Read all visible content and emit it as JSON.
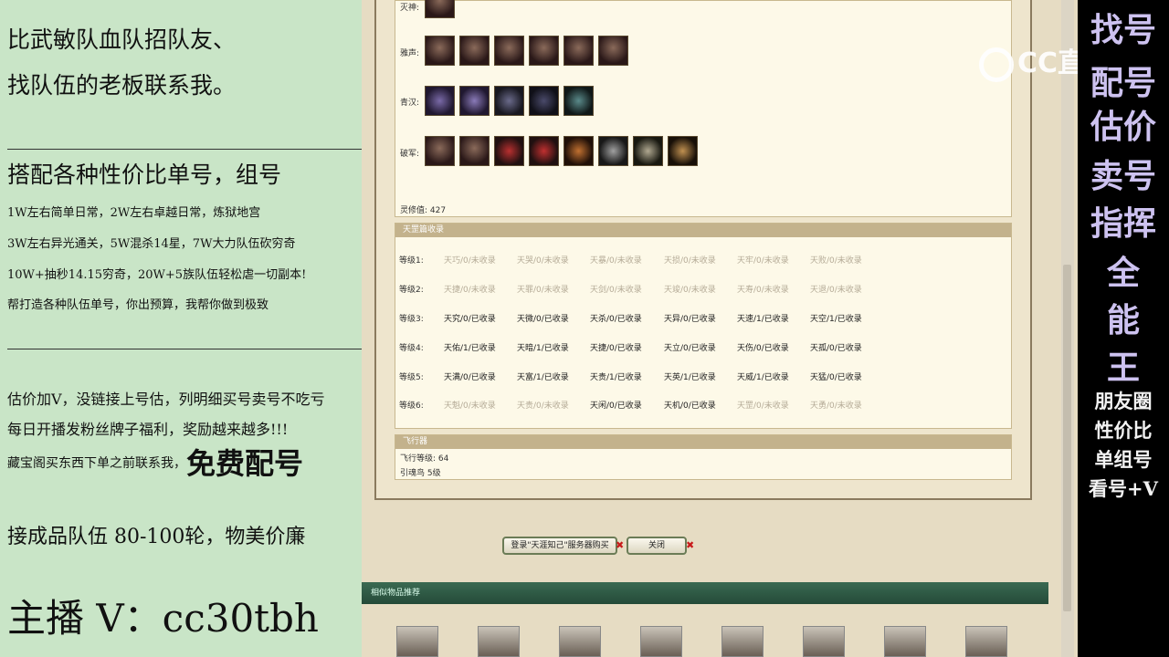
{
  "left_panel": {
    "line1": "比武敏队血队招队友、",
    "line2": "找队伍的老板联系我。",
    "line3": "搭配各种性价比单号，组号",
    "line4": "1W左右简单日常，2W左右卓越日常，炼狱地宫",
    "line5": "3W左右异光通关，5W混杀14星，7W大力队伍砍穷奇",
    "line6": "10W+抽秒14.15穷奇，20W+5族队伍轻松虐一切副本!",
    "line7": "帮打造各种队伍单号，你出预算，我帮你做到极致",
    "line8": "估价加V，没链接上号估，列明细买号卖号不吃亏",
    "line9": "每日开播发粉丝牌子福利，奖励越来越多!!!",
    "line10a": "藏宝阁买东西下单之前联系我，",
    "line10b": "免费配号",
    "line11": "接成品队伍 80-100轮，物美价廉",
    "line12": "主播 V：cc30tbh"
  },
  "equipment": {
    "row1_label": "灭神:",
    "row2_label": "雅声:",
    "row3_label": "青汉:",
    "row4_label": "破军:",
    "lingxiu_label": "灵修值: 427"
  },
  "tiangang": {
    "header": "天罡篇收录",
    "rows": [
      {
        "level": "等级1:",
        "cells": [
          "天巧/0/未收录",
          "天哭/0/未收录",
          "天暴/0/未收录",
          "天损/0/未收录",
          "天牢/0/未收录",
          "天败/0/未收录"
        ],
        "on": [
          false,
          false,
          false,
          false,
          false,
          false
        ]
      },
      {
        "level": "等级2:",
        "cells": [
          "天捷/0/未收录",
          "天罪/0/未收录",
          "天剑/0/未收录",
          "天竣/0/未收录",
          "天寿/0/未收录",
          "天退/0/未收录"
        ],
        "on": [
          false,
          false,
          false,
          false,
          false,
          false
        ]
      },
      {
        "level": "等级3:",
        "cells": [
          "天究/0/已收录",
          "天微/0/已收录",
          "天杀/0/已收录",
          "天异/0/已收录",
          "天速/1/已收录",
          "天空/1/已收录"
        ],
        "on": [
          true,
          true,
          true,
          true,
          true,
          true
        ]
      },
      {
        "level": "等级4:",
        "cells": [
          "天佑/1/已收录",
          "天暗/1/已收录",
          "天捷/0/已收录",
          "天立/0/已收录",
          "天伤/0/已收录",
          "天孤/0/已收录"
        ],
        "on": [
          true,
          true,
          true,
          true,
          true,
          true
        ]
      },
      {
        "level": "等级5:",
        "cells": [
          "天满/0/已收录",
          "天富/1/已收录",
          "天贵/1/已收录",
          "天英/1/已收录",
          "天威/1/已收录",
          "天猛/0/已收录"
        ],
        "on": [
          true,
          true,
          true,
          true,
          true,
          true
        ]
      },
      {
        "level": "等级6:",
        "cells": [
          "天魁/0/未收录",
          "天贵/0/未收录",
          "天闲/0/已收录",
          "天机/0/已收录",
          "天罡/0/未收录",
          "天勇/0/未收录"
        ],
        "on": [
          false,
          false,
          true,
          true,
          false,
          false
        ]
      }
    ]
  },
  "flight": {
    "header": "飞行器",
    "level": "飞行等级: 64",
    "engine": "引魂鸟  5级"
  },
  "buttons": {
    "login": "登录\"天涯知己\"服务器购买",
    "close": "关闭",
    "x_mark": "✖"
  },
  "similar": {
    "header": "相似物品推荐"
  },
  "right_panel": {
    "big": [
      "找号",
      "配号",
      "估价",
      "卖号",
      "指挥",
      "全",
      "能",
      "王"
    ],
    "small": [
      "朋友圈",
      "性价比",
      "单组号",
      "看号+V"
    ]
  },
  "watermark": {
    "text": "CC直播"
  }
}
